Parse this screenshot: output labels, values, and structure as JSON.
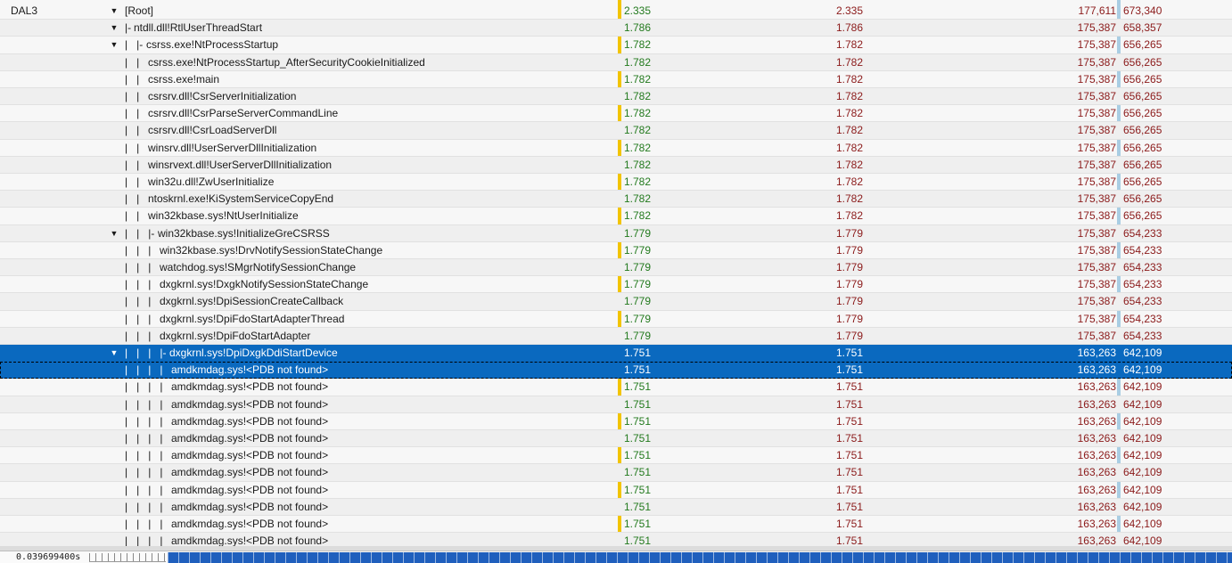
{
  "thread": "DAL3",
  "accent_colors": {
    "selection": "#0a69bf",
    "weight_text": "#237a1e",
    "count_text": "#8b1a1a",
    "divider_yellow": "#f2c400",
    "divider_blue": "#a9cde3"
  },
  "rows": [
    {
      "prefix": "",
      "name": "[Root]",
      "w1": "2.335",
      "w2": "2.335",
      "count": "177,611",
      "size": "673,340",
      "expander": "open"
    },
    {
      "prefix": "|- ",
      "name": "ntdll.dll!RtlUserThreadStart",
      "w1": "1.786",
      "w2": "1.786",
      "count": "175,387",
      "size": "658,357",
      "expander": "open"
    },
    {
      "prefix": "|   |- ",
      "name": "csrss.exe!NtProcessStartup",
      "w1": "1.782",
      "w2": "1.782",
      "count": "175,387",
      "size": "656,265",
      "expander": "open"
    },
    {
      "prefix": "|   |   ",
      "name": "csrss.exe!NtProcessStartup_AfterSecurityCookieInitialized",
      "w1": "1.782",
      "w2": "1.782",
      "count": "175,387",
      "size": "656,265",
      "expander": ""
    },
    {
      "prefix": "|   |   ",
      "name": "csrss.exe!main",
      "w1": "1.782",
      "w2": "1.782",
      "count": "175,387",
      "size": "656,265",
      "expander": ""
    },
    {
      "prefix": "|   |   ",
      "name": "csrsrv.dll!CsrServerInitialization",
      "w1": "1.782",
      "w2": "1.782",
      "count": "175,387",
      "size": "656,265",
      "expander": ""
    },
    {
      "prefix": "|   |   ",
      "name": "csrsrv.dll!CsrParseServerCommandLine",
      "w1": "1.782",
      "w2": "1.782",
      "count": "175,387",
      "size": "656,265",
      "expander": ""
    },
    {
      "prefix": "|   |   ",
      "name": "csrsrv.dll!CsrLoadServerDll",
      "w1": "1.782",
      "w2": "1.782",
      "count": "175,387",
      "size": "656,265",
      "expander": ""
    },
    {
      "prefix": "|   |   ",
      "name": "winsrv.dll!UserServerDllInitialization",
      "w1": "1.782",
      "w2": "1.782",
      "count": "175,387",
      "size": "656,265",
      "expander": ""
    },
    {
      "prefix": "|   |   ",
      "name": "winsrvext.dll!UserServerDllInitialization",
      "w1": "1.782",
      "w2": "1.782",
      "count": "175,387",
      "size": "656,265",
      "expander": ""
    },
    {
      "prefix": "|   |   ",
      "name": "win32u.dll!ZwUserInitialize",
      "w1": "1.782",
      "w2": "1.782",
      "count": "175,387",
      "size": "656,265",
      "expander": ""
    },
    {
      "prefix": "|   |   ",
      "name": "ntoskrnl.exe!KiSystemServiceCopyEnd",
      "w1": "1.782",
      "w2": "1.782",
      "count": "175,387",
      "size": "656,265",
      "expander": ""
    },
    {
      "prefix": "|   |   ",
      "name": "win32kbase.sys!NtUserInitialize",
      "w1": "1.782",
      "w2": "1.782",
      "count": "175,387",
      "size": "656,265",
      "expander": ""
    },
    {
      "prefix": "|   |   |- ",
      "name": "win32kbase.sys!InitializeGreCSRSS",
      "w1": "1.779",
      "w2": "1.779",
      "count": "175,387",
      "size": "654,233",
      "expander": "open"
    },
    {
      "prefix": "|   |   |   ",
      "name": "win32kbase.sys!DrvNotifySessionStateChange",
      "w1": "1.779",
      "w2": "1.779",
      "count": "175,387",
      "size": "654,233",
      "expander": ""
    },
    {
      "prefix": "|   |   |   ",
      "name": "watchdog.sys!SMgrNotifySessionChange",
      "w1": "1.779",
      "w2": "1.779",
      "count": "175,387",
      "size": "654,233",
      "expander": ""
    },
    {
      "prefix": "|   |   |   ",
      "name": "dxgkrnl.sys!DxgkNotifySessionStateChange",
      "w1": "1.779",
      "w2": "1.779",
      "count": "175,387",
      "size": "654,233",
      "expander": ""
    },
    {
      "prefix": "|   |   |   ",
      "name": "dxgkrnl.sys!DpiSessionCreateCallback",
      "w1": "1.779",
      "w2": "1.779",
      "count": "175,387",
      "size": "654,233",
      "expander": ""
    },
    {
      "prefix": "|   |   |   ",
      "name": "dxgkrnl.sys!DpiFdoStartAdapterThread",
      "w1": "1.779",
      "w2": "1.779",
      "count": "175,387",
      "size": "654,233",
      "expander": ""
    },
    {
      "prefix": "|   |   |   ",
      "name": "dxgkrnl.sys!DpiFdoStartAdapter",
      "w1": "1.779",
      "w2": "1.779",
      "count": "175,387",
      "size": "654,233",
      "expander": ""
    },
    {
      "prefix": "|   |   |   |- ",
      "name": "dxgkrnl.sys!DpiDxgkDdiStartDevice",
      "w1": "1.751",
      "w2": "1.751",
      "count": "163,263",
      "size": "642,109",
      "expander": "open",
      "state": "selected"
    },
    {
      "prefix": "|   |   |   |   ",
      "name": "amdkmdag.sys!<PDB not found>",
      "w1": "1.751",
      "w2": "1.751",
      "count": "163,263",
      "size": "642,109",
      "expander": "",
      "state": "selected-focus"
    },
    {
      "prefix": "|   |   |   |   ",
      "name": "amdkmdag.sys!<PDB not found>",
      "w1": "1.751",
      "w2": "1.751",
      "count": "163,263",
      "size": "642,109",
      "expander": ""
    },
    {
      "prefix": "|   |   |   |   ",
      "name": "amdkmdag.sys!<PDB not found>",
      "w1": "1.751",
      "w2": "1.751",
      "count": "163,263",
      "size": "642,109",
      "expander": ""
    },
    {
      "prefix": "|   |   |   |   ",
      "name": "amdkmdag.sys!<PDB not found>",
      "w1": "1.751",
      "w2": "1.751",
      "count": "163,263",
      "size": "642,109",
      "expander": ""
    },
    {
      "prefix": "|   |   |   |   ",
      "name": "amdkmdag.sys!<PDB not found>",
      "w1": "1.751",
      "w2": "1.751",
      "count": "163,263",
      "size": "642,109",
      "expander": ""
    },
    {
      "prefix": "|   |   |   |   ",
      "name": "amdkmdag.sys!<PDB not found>",
      "w1": "1.751",
      "w2": "1.751",
      "count": "163,263",
      "size": "642,109",
      "expander": ""
    },
    {
      "prefix": "|   |   |   |   ",
      "name": "amdkmdag.sys!<PDB not found>",
      "w1": "1.751",
      "w2": "1.751",
      "count": "163,263",
      "size": "642,109",
      "expander": ""
    },
    {
      "prefix": "|   |   |   |   ",
      "name": "amdkmdag.sys!<PDB not found>",
      "w1": "1.751",
      "w2": "1.751",
      "count": "163,263",
      "size": "642,109",
      "expander": ""
    },
    {
      "prefix": "|   |   |   |   ",
      "name": "amdkmdag.sys!<PDB not found>",
      "w1": "1.751",
      "w2": "1.751",
      "count": "163,263",
      "size": "642,109",
      "expander": ""
    },
    {
      "prefix": "|   |   |   |   ",
      "name": "amdkmdag.sys!<PDB not found>",
      "w1": "1.751",
      "w2": "1.751",
      "count": "163,263",
      "size": "642,109",
      "expander": ""
    },
    {
      "prefix": "|   |   |   |   ",
      "name": "amdkmdag.sys!<PDB not found>",
      "w1": "1.751",
      "w2": "1.751",
      "count": "163,263",
      "size": "642,109",
      "expander": ""
    }
  ],
  "timeline": {
    "time_label": "0.039699400s"
  }
}
